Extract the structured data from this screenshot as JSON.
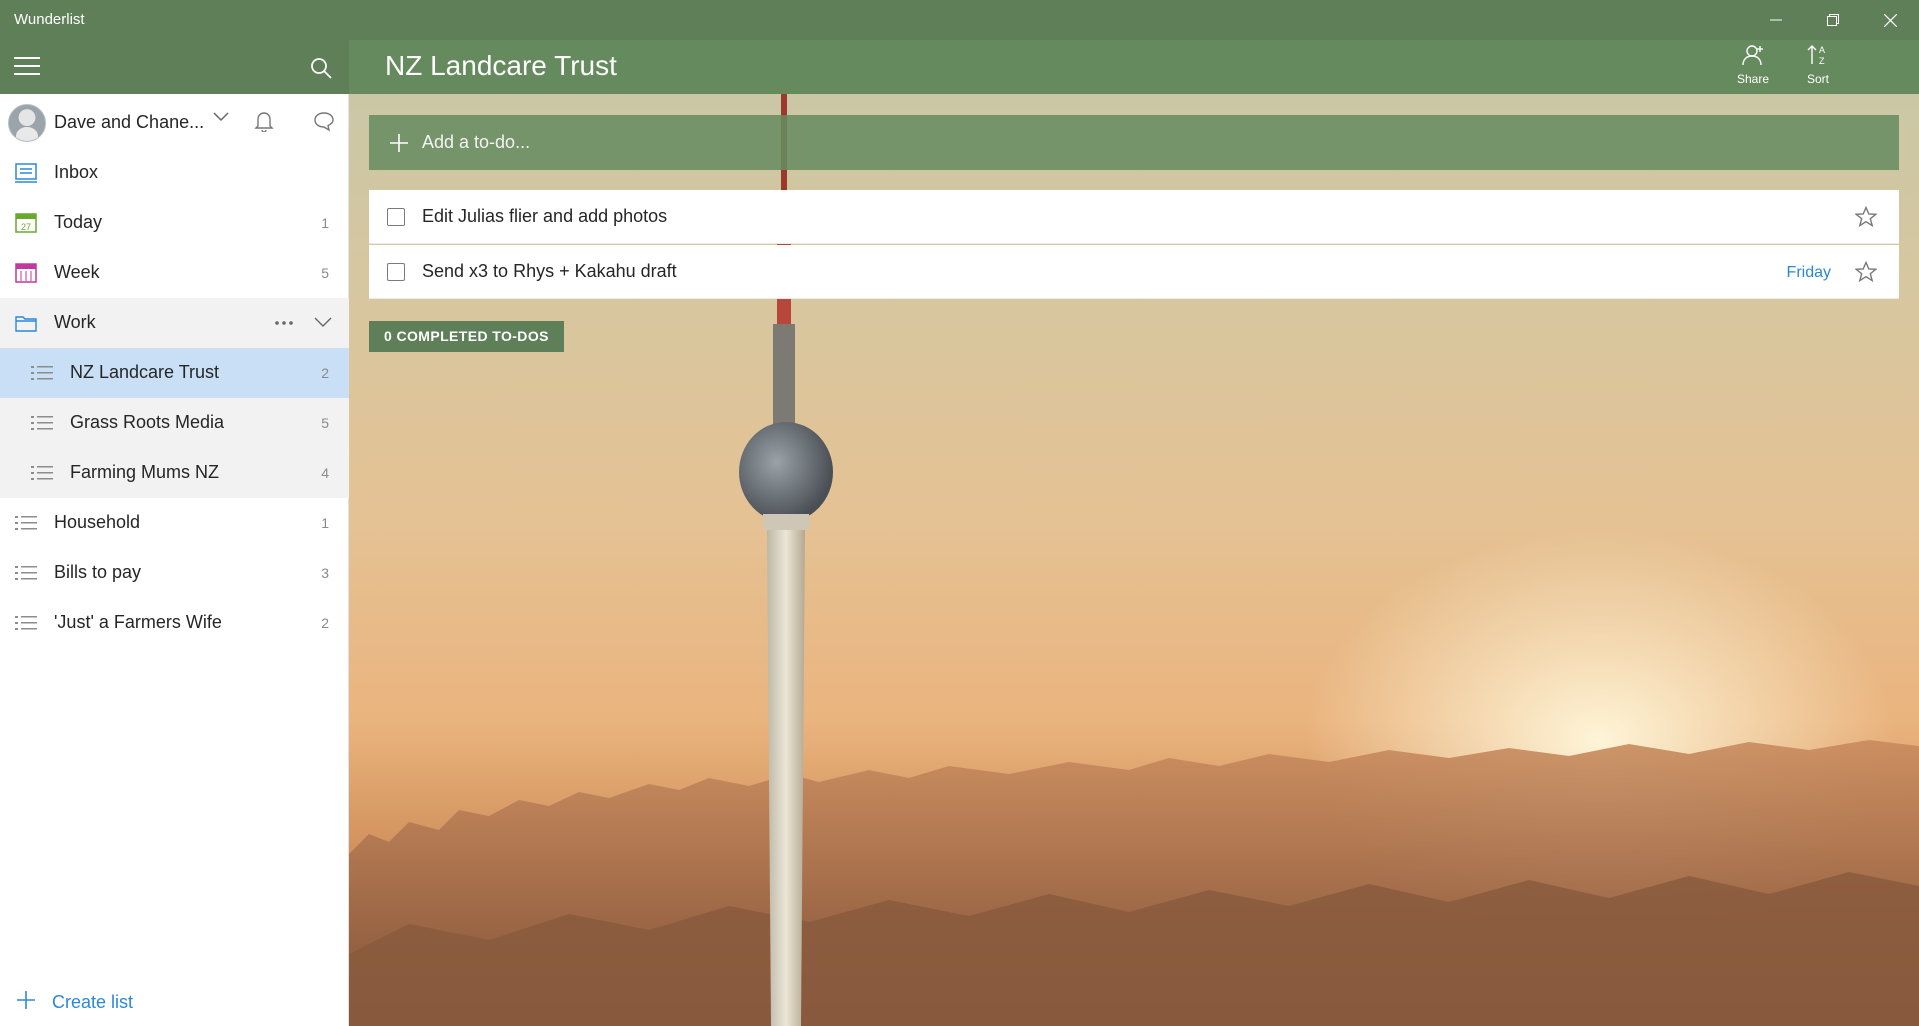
{
  "window": {
    "title": "Wunderlist"
  },
  "sidebar": {
    "user": {
      "name": "Dave and Chane..."
    },
    "items": [
      {
        "label": "Inbox",
        "count": "",
        "icon": "inbox-icon"
      },
      {
        "label": "Today",
        "count": "1",
        "icon": "calendar-today-icon",
        "day": "27"
      },
      {
        "label": "Week",
        "count": "5",
        "icon": "calendar-week-icon"
      },
      {
        "label": "Work",
        "count": "",
        "icon": "folder-icon"
      },
      {
        "label": "NZ Landcare Trust",
        "count": "2",
        "icon": "list-icon"
      },
      {
        "label": "Grass Roots Media",
        "count": "5",
        "icon": "list-icon"
      },
      {
        "label": "Farming Mums NZ",
        "count": "4",
        "icon": "list-icon"
      },
      {
        "label": "Household",
        "count": "1",
        "icon": "list-icon"
      },
      {
        "label": "Bills to pay",
        "count": "3",
        "icon": "list-icon"
      },
      {
        "label": "'Just' a Farmers Wife",
        "count": "2",
        "icon": "list-icon"
      }
    ],
    "create_list_label": "Create list"
  },
  "main": {
    "list_title": "NZ Landcare Trust",
    "share_label": "Share",
    "sort_label": "Sort",
    "add_placeholder": "Add a to-do...",
    "tasks": [
      {
        "title": "Edit Julias flier and add photos",
        "due": "",
        "starred": false
      },
      {
        "title": "Send x3 to Rhys + Kakahu draft",
        "due": "Friday",
        "starred": false
      }
    ],
    "completed_label": "0 COMPLETED TO-DOS"
  },
  "colors": {
    "header_green": "#5f7f58",
    "selected_list": "#c8dff5",
    "accent_blue": "#2b88d8"
  }
}
